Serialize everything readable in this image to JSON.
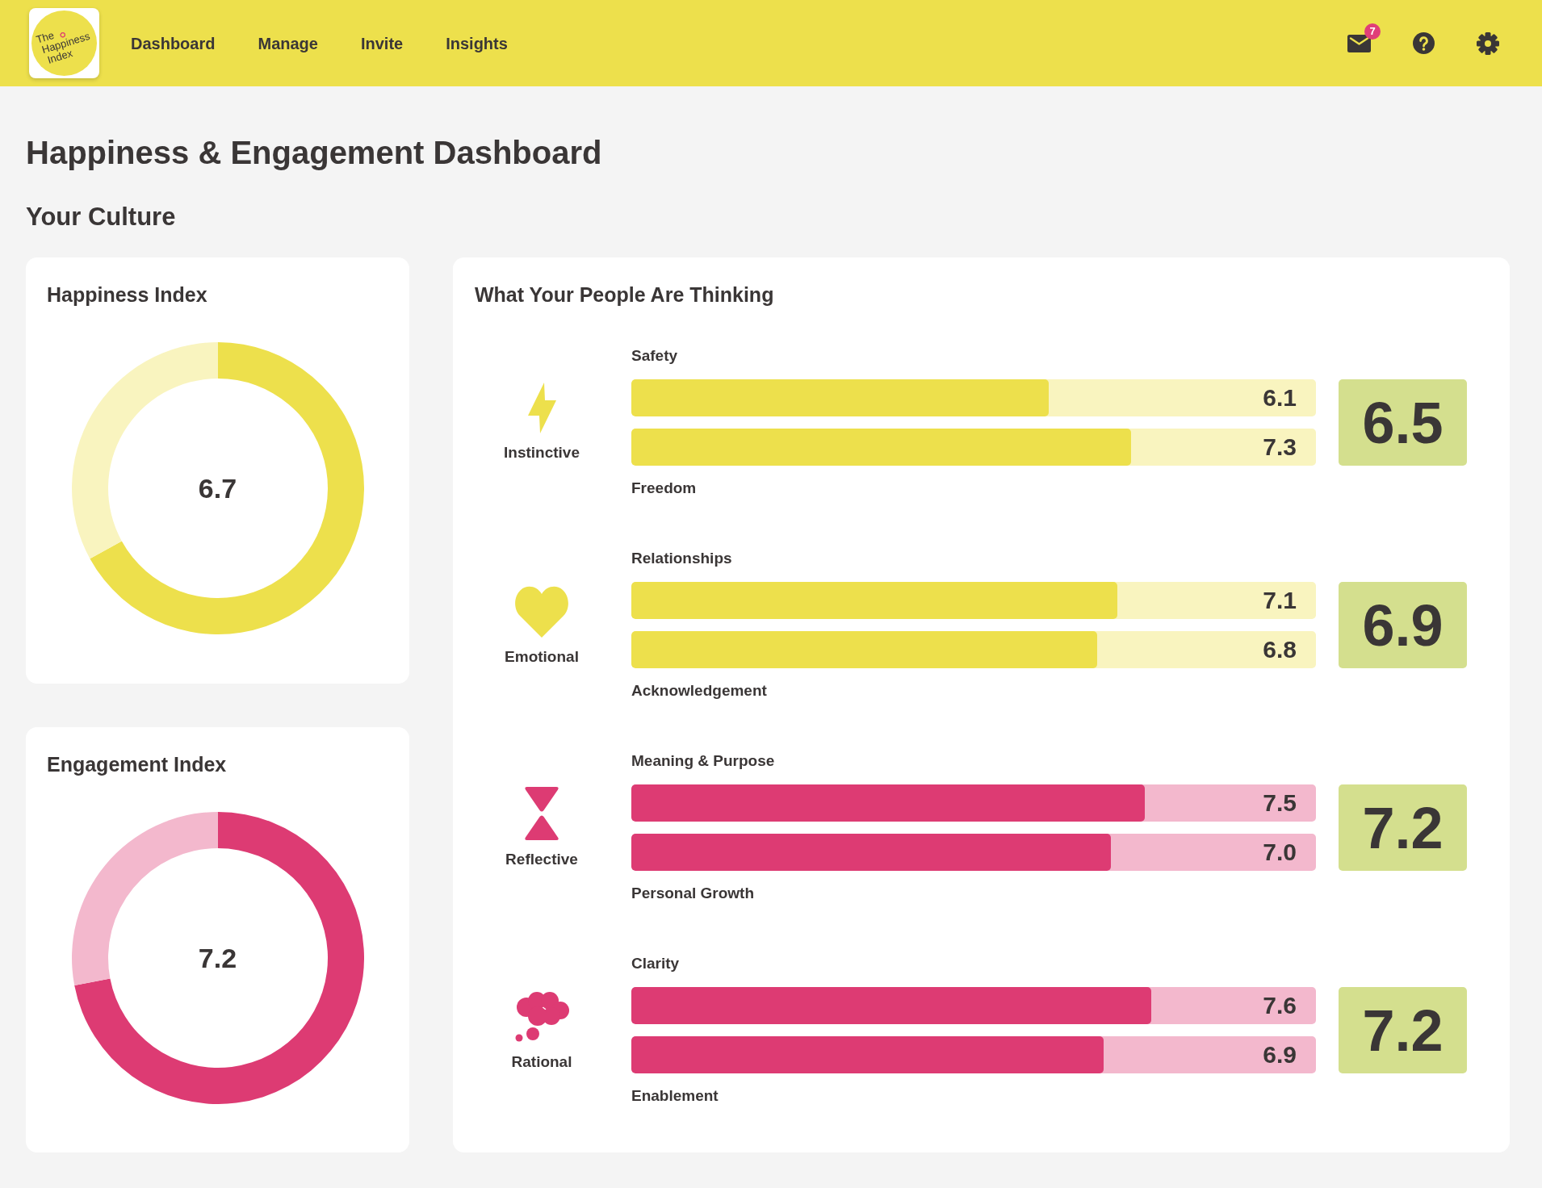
{
  "header": {
    "logo": {
      "lines": [
        "The",
        "Happiness",
        "Index"
      ]
    },
    "nav": [
      {
        "label": "Dashboard"
      },
      {
        "label": "Manage"
      },
      {
        "label": "Invite"
      },
      {
        "label": "Insights"
      }
    ],
    "mail_badge": "7"
  },
  "page": {
    "title": "Happiness & Engagement Dashboard",
    "section": "Your Culture"
  },
  "index_cards": [
    {
      "title": "Happiness Index",
      "value": "6.7",
      "color": "#ede04c",
      "chart_data": {
        "type": "donut",
        "values": [
          67,
          33
        ]
      }
    },
    {
      "title": "Engagement Index",
      "value": "7.2",
      "color": "#dd3b73",
      "chart_data": {
        "type": "donut",
        "values": [
          72,
          28
        ]
      }
    }
  ],
  "thinking": {
    "title": "What Your People Are Thinking",
    "groups": [
      {
        "label": "Instinctive",
        "color": "#ede04c",
        "score": "6.5",
        "bars": [
          {
            "label": "Safety",
            "value": "6.1",
            "level": 0.61
          },
          {
            "label": "Freedom",
            "value": "7.3",
            "level": 0.73
          }
        ]
      },
      {
        "label": "Emotional",
        "color": "#ede04c",
        "score": "6.9",
        "bars": [
          {
            "label": "Relationships",
            "value": "7.1",
            "level": 0.71
          },
          {
            "label": "Acknowledgement",
            "value": "6.8",
            "level": 0.68
          }
        ]
      },
      {
        "label": "Reflective",
        "color": "#dd3b73",
        "score": "7.2",
        "bars": [
          {
            "label": "Meaning & Purpose",
            "value": "7.5",
            "level": 0.75
          },
          {
            "label": "Personal Growth",
            "value": "7.0",
            "level": 0.7
          }
        ]
      },
      {
        "label": "Rational",
        "color": "#dd3b73",
        "score": "7.2",
        "bars": [
          {
            "label": "Clarity",
            "value": "7.6",
            "level": 0.76
          },
          {
            "label": "Enablement",
            "value": "6.9",
            "level": 0.69
          }
        ]
      }
    ]
  }
}
